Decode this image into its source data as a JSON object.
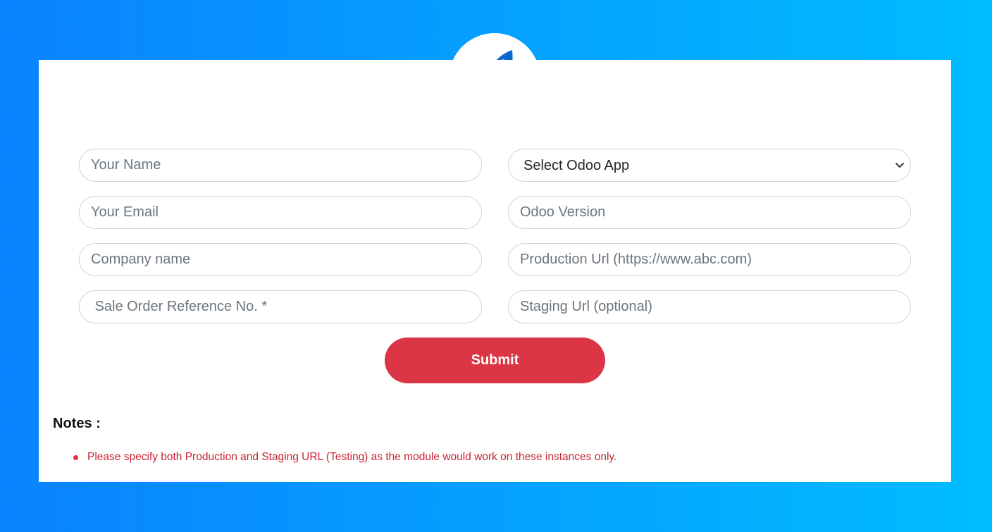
{
  "form": {
    "name_placeholder": "Your Name",
    "email_placeholder": "Your Email",
    "company_placeholder": "Company name",
    "sale_order_placeholder": " Sale Order Reference No. *",
    "app_select_value": "Select Odoo App",
    "version_placeholder": "Odoo Version",
    "production_url_placeholder": "Production Url (https://www.abc.com)",
    "staging_url_placeholder": "Staging Url (optional)",
    "submit_label": "Submit"
  },
  "notes": {
    "title": "Notes :",
    "items": [
      "Please specify both Production and Staging URL (Testing) as the module would work on these instances only."
    ]
  },
  "icons": {
    "header": "rocket-icon",
    "select": "chevron-down-icon"
  },
  "colors": {
    "background_start": "#0a82ff",
    "background_end": "#00bcff",
    "accent": "#0066cc",
    "submit": "#dc3545",
    "note_text": "#c82333"
  }
}
